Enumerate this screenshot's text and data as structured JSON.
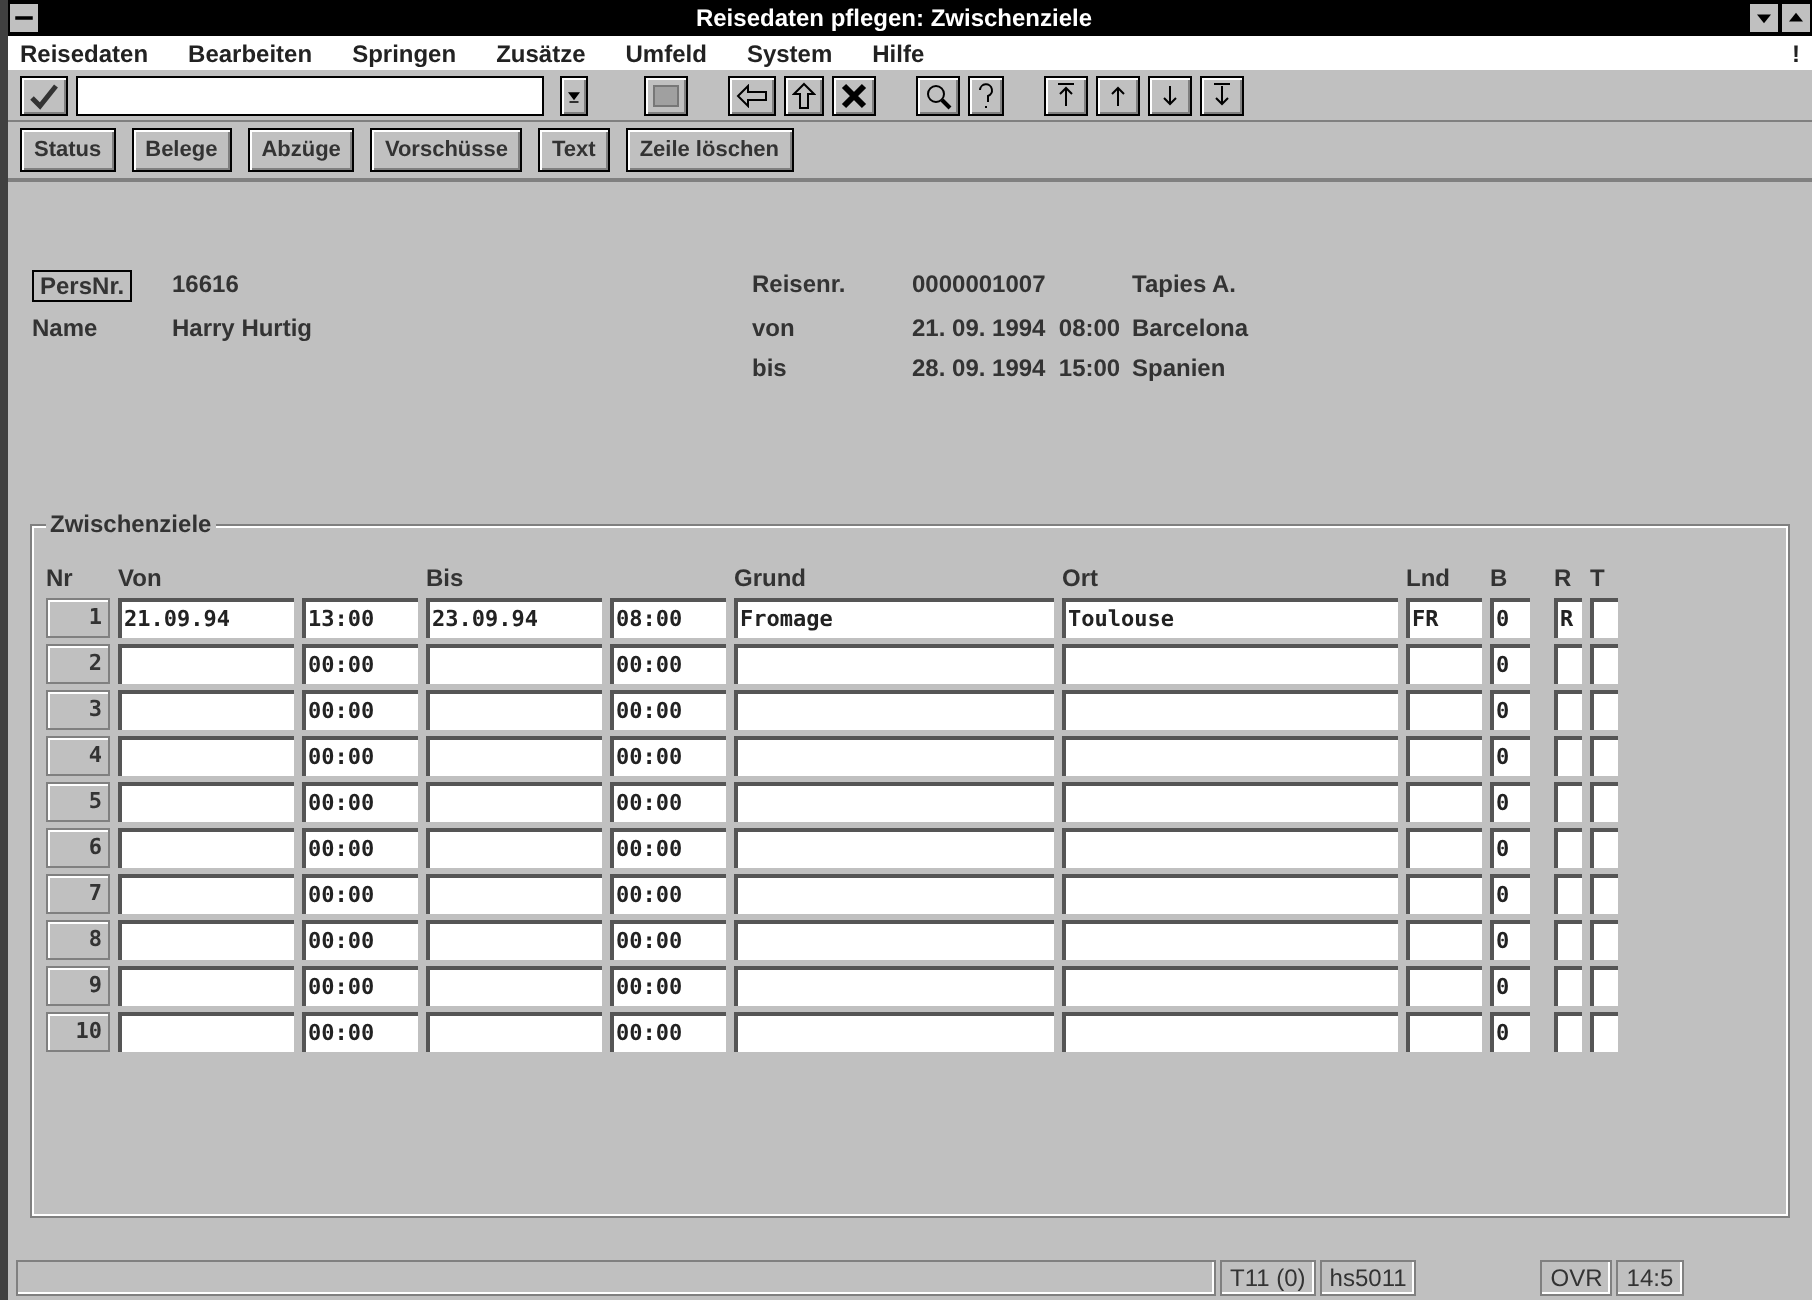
{
  "window": {
    "title": "Reisedaten pflegen: Zwischenziele"
  },
  "menu": [
    "Reisedaten",
    "Bearbeiten",
    "Springen",
    "Zusätze",
    "Umfeld",
    "System",
    "Hilfe"
  ],
  "menu_end": "!",
  "app_toolbar": [
    "Status",
    "Belege",
    "Abzüge",
    "Vorschüsse",
    "Text",
    "Zeile löschen"
  ],
  "header": {
    "persnr_label": "PersNr.",
    "persnr": "16616",
    "name_label": "Name",
    "name": "Harry Hurtig",
    "reisenr_label": "Reisenr.",
    "reisenr": "0000001007",
    "reisender": "Tapies A.",
    "von_label": "von",
    "von": "21. 09. 1994  08:00",
    "von_ort": "Barcelona",
    "bis_label": "bis",
    "bis": "28. 09. 1994  15:00",
    "bis_land": "Spanien"
  },
  "group": {
    "title": "Zwischenziele",
    "columns": [
      "Nr",
      "Von",
      "Bis",
      "Grund",
      "Ort",
      "Lnd",
      "B",
      "R",
      "T"
    ],
    "rows": [
      {
        "nr": "1",
        "von": "21.09.94",
        "von_zeit": "13:00",
        "bis": "23.09.94",
        "bis_zeit": "08:00",
        "grund": "Fromage",
        "ort": "Toulouse",
        "lnd": "FR",
        "b": "0",
        "r": "R"
      },
      {
        "nr": "2",
        "von_zeit": "00:00",
        "bis_zeit": "00:00",
        "b": "0"
      },
      {
        "nr": "3",
        "von_zeit": "00:00",
        "bis_zeit": "00:00",
        "b": "0"
      },
      {
        "nr": "4",
        "von_zeit": "00:00",
        "bis_zeit": "00:00",
        "b": "0"
      },
      {
        "nr": "5",
        "von_zeit": "00:00",
        "bis_zeit": "00:00",
        "b": "0"
      },
      {
        "nr": "6",
        "von_zeit": "00:00",
        "bis_zeit": "00:00",
        "b": "0"
      },
      {
        "nr": "7",
        "von_zeit": "00:00",
        "bis_zeit": "00:00",
        "b": "0"
      },
      {
        "nr": "8",
        "von_zeit": "00:00",
        "bis_zeit": "00:00",
        "b": "0"
      },
      {
        "nr": "9",
        "von_zeit": "00:00",
        "bis_zeit": "00:00",
        "b": "0"
      },
      {
        "nr": "10",
        "von_zeit": "00:00",
        "bis_zeit": "00:00",
        "b": "0"
      }
    ]
  },
  "status_bar": [
    "T11 (0)",
    "hs5011",
    "OVR",
    "14:5"
  ]
}
